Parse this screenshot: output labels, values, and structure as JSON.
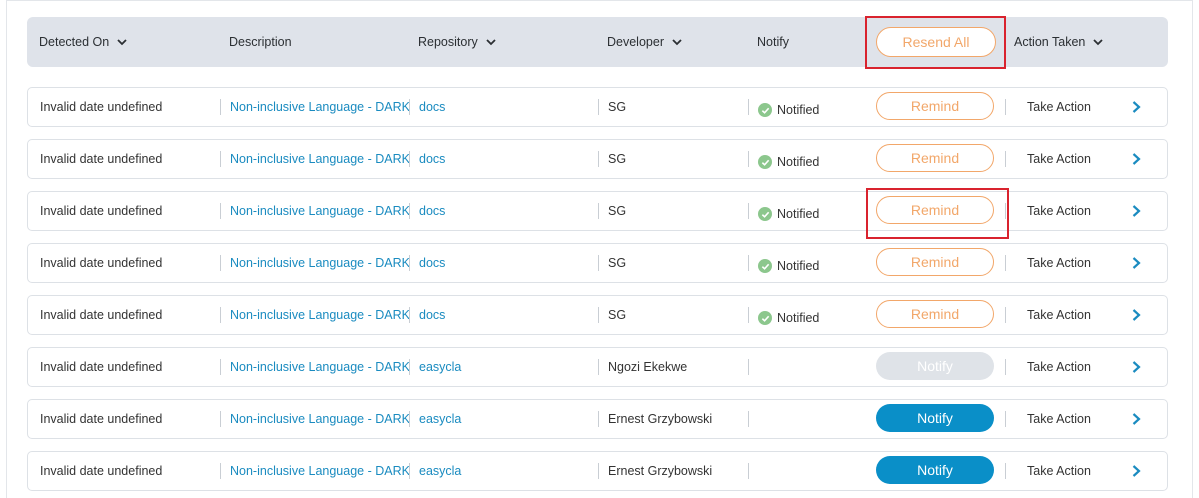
{
  "header": {
    "detected_on": "Detected On",
    "description": "Description",
    "repository": "Repository",
    "developer": "Developer",
    "notify": "Notify",
    "resend_all": "Resend All",
    "action_taken": "Action Taken"
  },
  "colors": {
    "accent_orange": "#f2a76a",
    "link_blue": "#1a8bc0",
    "notify_blue": "#0a8fc8",
    "highlight_red": "#d9232e"
  },
  "rows": [
    {
      "detected": "Invalid date undefined",
      "description": "Non-inclusive Language - DARK",
      "repo": "docs",
      "developer": "SG",
      "status": "Notified",
      "button": "Remind",
      "button_state": "remind",
      "action": "Take Action"
    },
    {
      "detected": "Invalid date undefined",
      "description": "Non-inclusive Language - DARK",
      "repo": "docs",
      "developer": "SG",
      "status": "Notified",
      "button": "Remind",
      "button_state": "remind",
      "action": "Take Action"
    },
    {
      "detected": "Invalid date undefined",
      "description": "Non-inclusive Language - DARK",
      "repo": "docs",
      "developer": "SG",
      "status": "Notified",
      "button": "Remind",
      "button_state": "remind",
      "action": "Take Action"
    },
    {
      "detected": "Invalid date undefined",
      "description": "Non-inclusive Language - DARK",
      "repo": "docs",
      "developer": "SG",
      "status": "Notified",
      "button": "Remind",
      "button_state": "remind",
      "action": "Take Action"
    },
    {
      "detected": "Invalid date undefined",
      "description": "Non-inclusive Language - DARK",
      "repo": "docs",
      "developer": "SG",
      "status": "Notified",
      "button": "Remind",
      "button_state": "remind",
      "action": "Take Action"
    },
    {
      "detected": "Invalid date undefined",
      "description": "Non-inclusive Language - DARK",
      "repo": "easycla",
      "developer": "Ngozi Ekekwe",
      "status": "",
      "button": "Notify",
      "button_state": "disabled",
      "action": "Take Action"
    },
    {
      "detected": "Invalid date undefined",
      "description": "Non-inclusive Language - DARK",
      "repo": "easycla",
      "developer": "Ernest Grzybowski",
      "status": "",
      "button": "Notify",
      "button_state": "active",
      "action": "Take Action"
    },
    {
      "detected": "Invalid date undefined",
      "description": "Non-inclusive Language - DARK",
      "repo": "easycla",
      "developer": "Ernest Grzybowski",
      "status": "",
      "button": "Notify",
      "button_state": "active",
      "action": "Take Action"
    }
  ]
}
